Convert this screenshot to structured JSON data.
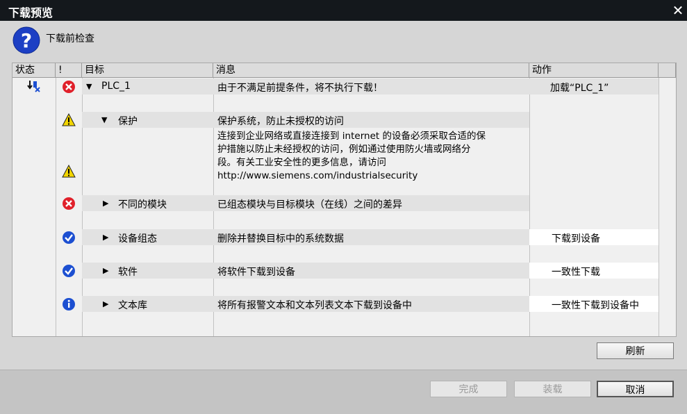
{
  "window": {
    "title": "下载预览",
    "close_glyph": "✕"
  },
  "header": {
    "text": "下载前检查"
  },
  "columns": {
    "status": "状态",
    "flag": "!",
    "target": "目标",
    "message": "消息",
    "action": "动作"
  },
  "rows": {
    "plc": {
      "target": "PLC_1",
      "message": "由于不满足前提条件，将不执行下载！",
      "action": "加载“PLC_1”"
    },
    "protect": {
      "target": "保护",
      "message": "保护系统，防止未授权的访问"
    },
    "protect_detail": {
      "line1": "连接到企业网络或直接连接到 internet 的设备必须采取合适的保",
      "line2": "护措施以防止未经授权的访问，例如通过使用防火墙或网络分",
      "line3": "段。有关工业安全性的更多信息，请访问",
      "line4": "http://www.siemens.com/industrialsecurity"
    },
    "modules": {
      "target": "不同的模块",
      "message": "已组态模块与目标模块（在线）之间的差异"
    },
    "devconfig": {
      "target": "设备组态",
      "message": "删除并替换目标中的系统数据",
      "action": "下载到设备"
    },
    "software": {
      "target": "软件",
      "message": "将软件下载到设备",
      "action": "一致性下载"
    },
    "textlib": {
      "target": "文本库",
      "message": "将所有报警文本和文本列表文本下载到设备中",
      "action": "一致性下载到设备中"
    }
  },
  "buttons": {
    "refresh": "刷新",
    "finish": "完成",
    "load": "装载",
    "cancel": "取消"
  },
  "colors": {
    "error": "#e0202a",
    "ok": "#1c4fd1",
    "info": "#1c4fd1",
    "warning": "#f2d500"
  }
}
